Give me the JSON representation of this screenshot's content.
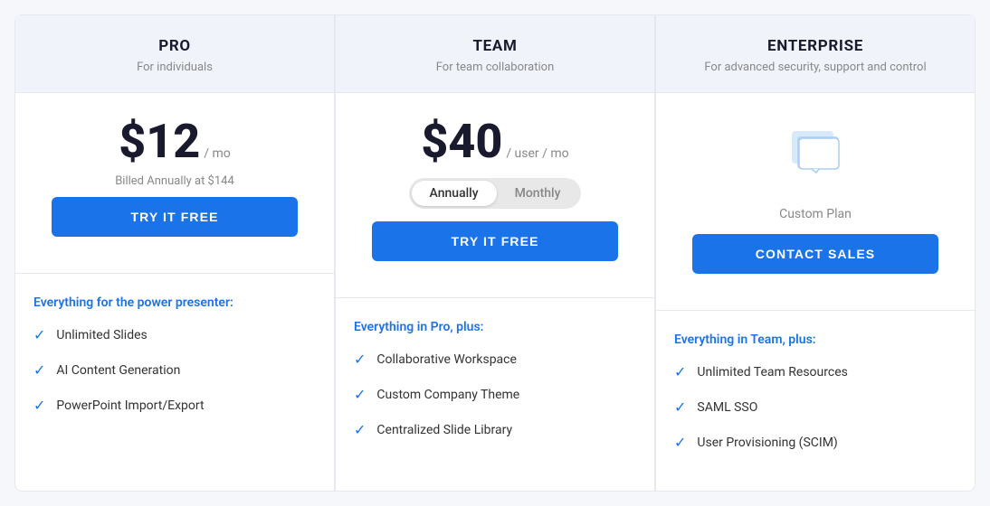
{
  "plans": [
    {
      "id": "pro",
      "name": "PRO",
      "tagline": "For individuals",
      "price": "$12",
      "priceUnit": "/ mo",
      "billingNote": "Billed Annually at $144",
      "ctaLabel": "TRY IT FREE",
      "ctaType": "primary",
      "featuresHeading": "Everything for the power presenter:",
      "features": [
        "Unlimited Slides",
        "AI Content Generation",
        "PowerPoint Import/Export"
      ]
    },
    {
      "id": "team",
      "name": "TEAM",
      "tagline": "For team collaboration",
      "price": "$40",
      "priceUnit": "/ user / mo",
      "toggle": {
        "options": [
          "Annually",
          "Monthly"
        ],
        "active": "Annually"
      },
      "ctaLabel": "TRY IT FREE",
      "ctaType": "primary",
      "featuresHeading": "Everything in Pro, plus:",
      "features": [
        "Collaborative Workspace",
        "Custom Company Theme",
        "Centralized Slide Library"
      ]
    },
    {
      "id": "enterprise",
      "name": "ENTERPRISE",
      "tagline": "For advanced security, support and control",
      "customPlanLabel": "Custom Plan",
      "ctaLabel": "CONTACT SALES",
      "ctaType": "primary",
      "featuresHeading": "Everything in Team, plus:",
      "features": [
        "Unlimited Team Resources",
        "SAML SSO",
        "User Provisioning (SCIM)"
      ]
    }
  ],
  "icons": {
    "check": "✓",
    "enterprise_icon": "chat-icon"
  }
}
